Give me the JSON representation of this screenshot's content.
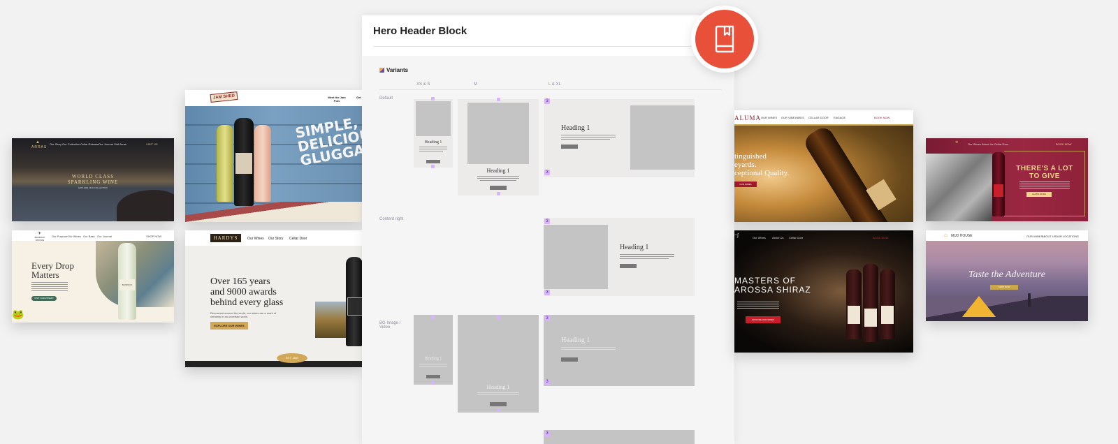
{
  "panel": {
    "title": "Hero Header Block",
    "variants_title": "Variants",
    "columns": [
      "XS & S",
      "M",
      "L & XL"
    ],
    "rows": [
      "Default",
      "Content right",
      "BG Image / Video"
    ],
    "variant_heading": "Heading 1",
    "marker": "3",
    "badge_icon": "book-icon"
  },
  "shots": {
    "arras": {
      "logo": "ARRAS",
      "nav": [
        "Our Story",
        "Our Collection",
        "Cellar Release",
        "Our Journal",
        "Visit Arras"
      ],
      "cta": "VISIT US",
      "headline": "WORLD CLASS\nSPARKLING WINE",
      "sub": "EXPLORE OUR COLLECTION"
    },
    "banrock": {
      "logo": "BANROCK STATION",
      "nav": [
        "Our Purpose",
        "Our Wines",
        "Our Bass",
        "Our Journal"
      ],
      "cta": "SHOP NOW",
      "headline": "Every Drop\nMatters",
      "button": "VISIT OUR WINERY",
      "bottle_label": "BANROCK"
    },
    "jamshed": {
      "logo": "JAM SHED",
      "nav": [
        "Meet the Jam Pots",
        "Get"
      ],
      "headline": "SIMPLE,\nDELICIOUS AND\nGLUGGABLE."
    },
    "hardys": {
      "logo": "HARDYS",
      "nav": [
        "Our Wines",
        "Our Story",
        "Cellar Door"
      ],
      "headline": "Over 165 years\nand 9000 awards\nbehind every glass",
      "body": "Renowned around the world, our wines are a mark of certainty in an uncertain world.",
      "button": "EXPLORE OUR WINES",
      "badge": "EST. 1853"
    },
    "saltram": {
      "logo": "ALUMA",
      "nav": [
        "OUR WINES",
        "OUR VINEYARDS",
        "CELLAR DOOR",
        "ENGAGE"
      ],
      "cta": "BOOK NOW",
      "headline": "tinguished\neyards.\nceptional Quality.",
      "button": "OUR WINES"
    },
    "pepperjack": {
      "nav": [
        "Our Wines",
        "About Us",
        "Cellar Door"
      ],
      "cta": "BOOK NOW",
      "headline": "MASTERS OF\nAROSSA SHIRAZ",
      "button": "EXPLORE OUR WINES"
    },
    "berri": {
      "nav": [
        "Our Wines",
        "About Us",
        "Cellar Door"
      ],
      "cta": "BOOK NOW",
      "headline": "THERE'S A LOT\nTO GIVE",
      "button": "LEARN MORE"
    },
    "mudhouse": {
      "logo": "MUD HOUSE",
      "nav": [
        "OUR WINES",
        "ABOUT US",
        "OUR LOCATIONS"
      ],
      "headline": "Taste the Adventure",
      "button": "SHOP NOW"
    }
  },
  "colors": {
    "badge_red": "#e8503a",
    "background": "#f2f2f2",
    "placeholder_gray": "#c4c4c4",
    "marker_purple": "#d9b3ff"
  }
}
